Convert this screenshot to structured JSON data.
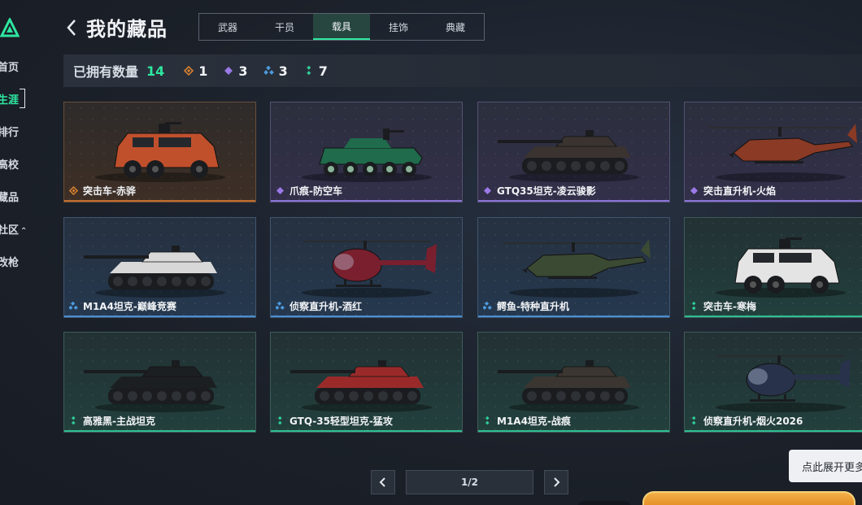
{
  "sidebar": {
    "items": [
      {
        "label": "首页",
        "active": false
      },
      {
        "label": "生涯",
        "active": true
      },
      {
        "label": "排行",
        "active": false
      },
      {
        "label": "高校",
        "active": false
      },
      {
        "label": "藏品",
        "active": false
      },
      {
        "label": "社区",
        "active": false
      },
      {
        "label": "改枪",
        "active": false
      }
    ]
  },
  "header": {
    "title": "我的藏品",
    "tabs": [
      {
        "label": "武器",
        "active": false
      },
      {
        "label": "干员",
        "active": false
      },
      {
        "label": "载具",
        "active": true
      },
      {
        "label": "挂饰",
        "active": false
      },
      {
        "label": "典藏",
        "active": false
      }
    ]
  },
  "summary": {
    "owned_label": "已拥有数量",
    "owned_count": "14",
    "rarities": [
      {
        "icon": "orange-diamond-icon",
        "color": "#d9812f",
        "count": "1"
      },
      {
        "icon": "purple-diamond-icon",
        "color": "#9b7ae8",
        "count": "3"
      },
      {
        "icon": "blue-diamond-icon",
        "color": "#4c9be0",
        "count": "3"
      },
      {
        "icon": "green-diamond-icon",
        "color": "#2fcf9a",
        "count": "7"
      }
    ]
  },
  "cards": [
    {
      "name": "突击车-赤骅",
      "rarity": "orange",
      "kind": "armored-car",
      "color": "#c0502c"
    },
    {
      "name": "爪痕-防空车",
      "rarity": "purple",
      "kind": "wheeled",
      "color": "#1f6b4c"
    },
    {
      "name": "GTQ35坦克-凌云骏影",
      "rarity": "purple",
      "kind": "tank",
      "color": "#3a3330"
    },
    {
      "name": "突击直升机-火焰",
      "rarity": "purple",
      "kind": "attack-heli",
      "color": "#8a3a25"
    },
    {
      "name": "M1A4坦克-巅峰竞赛",
      "rarity": "blue",
      "kind": "tank",
      "color": "#d8d8d8"
    },
    {
      "name": "侦察直升机-酒红",
      "rarity": "blue",
      "kind": "light-heli",
      "color": "#7a1f2e"
    },
    {
      "name": "鳄鱼-特种直升机",
      "rarity": "blue",
      "kind": "attack-heli",
      "color": "#3b4a33"
    },
    {
      "name": "突击车-寒梅",
      "rarity": "green",
      "kind": "armored-car",
      "color": "#e4e4e4"
    },
    {
      "name": "高雅黑-主战坦克",
      "rarity": "green",
      "kind": "tank",
      "color": "#1c1f22"
    },
    {
      "name": "GTQ-35轻型坦克-猛攻",
      "rarity": "green",
      "kind": "tank",
      "color": "#9a2a2a"
    },
    {
      "name": "M1A4坦克-战痕",
      "rarity": "green",
      "kind": "tank",
      "color": "#3b3631"
    },
    {
      "name": "侦察直升机-烟火2026",
      "rarity": "green",
      "kind": "light-heli",
      "color": "#28324a"
    }
  ],
  "pagination": {
    "indicator": "1/2",
    "prev_icon": "chevron-left-icon",
    "next_icon": "chevron-right-icon"
  },
  "expand_hint": "点此展开更多"
}
